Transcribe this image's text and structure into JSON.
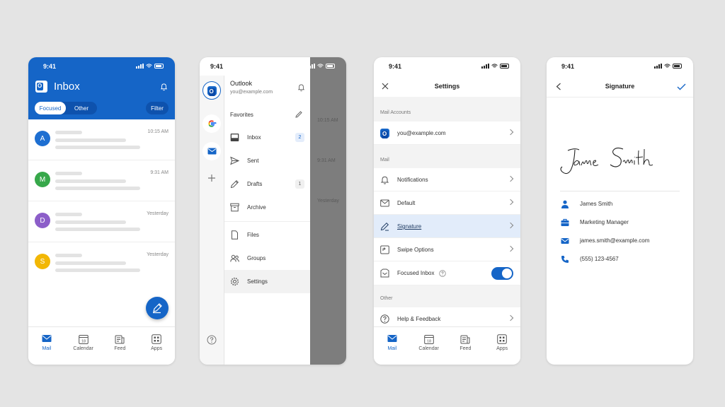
{
  "colors": {
    "accent": "#1565c7",
    "background": "#e4e4e4"
  },
  "status_time": "9:41",
  "inbox_screen": {
    "title": "Inbox",
    "tabs": [
      "Focused",
      "Other"
    ],
    "active_tab": "Focused",
    "filter_label": "Filter",
    "messages": [
      {
        "initial": "A",
        "time": "10:15 AM",
        "avatar_color": "#1e6fd1"
      },
      {
        "initial": "M",
        "time": "9:31 AM",
        "avatar_color": "#37a84a"
      },
      {
        "initial": "D",
        "time": "Yesterday",
        "avatar_color": "#8c5ec9"
      },
      {
        "initial": "S",
        "time": "Yesterday",
        "avatar_color": "#f2b705"
      }
    ],
    "compose_icon": "pencil-icon"
  },
  "tab_bar": [
    "Mail",
    "Calendar",
    "Feed",
    "Apps"
  ],
  "calendar_day": "18",
  "drawer_screen": {
    "account_name": "Outlook",
    "account_email": "you@example.com",
    "favorites_label": "Favorites",
    "folders": [
      {
        "label": "Inbox",
        "count": "2",
        "icon": "inbox-icon"
      },
      {
        "label": "Sent",
        "count": "",
        "icon": "send-icon"
      },
      {
        "label": "Drafts",
        "count": "1",
        "icon": "pencil-icon"
      },
      {
        "label": "Archive",
        "count": "",
        "icon": "archive-icon"
      }
    ],
    "more": [
      {
        "label": "Files",
        "icon": "file-icon"
      },
      {
        "label": "Groups",
        "icon": "groups-icon"
      },
      {
        "label": "Settings",
        "icon": "gear-icon"
      }
    ],
    "background_times": [
      "10:15 AM",
      "9:31 AM",
      "Yesterday"
    ]
  },
  "settings_screen": {
    "title": "Settings",
    "mail_accounts_label": "Mail Accounts",
    "account_email": "you@example.com",
    "mail_label": "Mail",
    "mail_rows": [
      "Notifications",
      "Default",
      "Signature",
      "Swipe Options"
    ],
    "focused_inbox_label": "Focused Inbox",
    "focused_inbox_on": true,
    "other_label": "Other",
    "help_label": "Help & Feedback"
  },
  "signature_screen": {
    "title": "Signature",
    "signature_script": "James Smith",
    "contact": {
      "name": "James Smith",
      "job_title": "Marketing Manager",
      "email": "james.smith@example.com",
      "phone": "(555) 123-4567"
    }
  }
}
